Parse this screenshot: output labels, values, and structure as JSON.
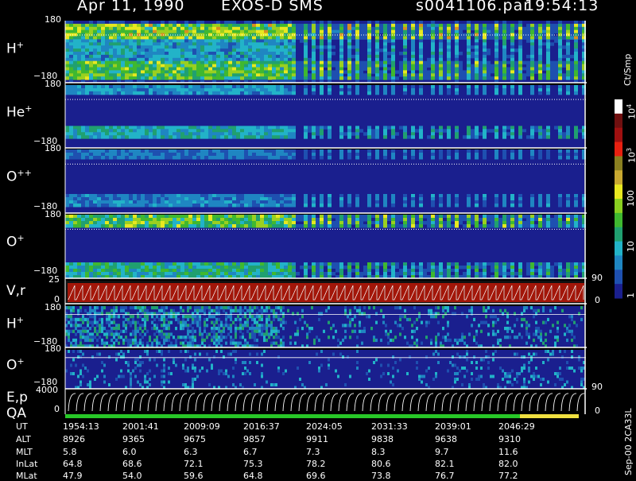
{
  "header": {
    "date": "Apr 11, 1990",
    "instrument": "EXOS-D SMS",
    "file": "s0041106.par",
    "time": "19:54:13"
  },
  "colorbar": {
    "unit": "Ct/Smp",
    "ticks": [
      "1",
      "10",
      "100",
      "10",
      "10"
    ],
    "tick_exps": [
      "",
      "",
      "",
      "3",
      "4"
    ]
  },
  "panels": [
    {
      "name": "H",
      "sup": "+",
      "top": "180",
      "bottom": "−180"
    },
    {
      "name": "He",
      "sup": "+",
      "top": "180",
      "bottom": "−180"
    },
    {
      "name": "O",
      "sup": "++",
      "top": "180",
      "bottom": "−180"
    },
    {
      "name": "O",
      "sup": "+",
      "top": "180",
      "bottom": "−180"
    },
    {
      "name": "V,r",
      "sup": "",
      "top": "25",
      "bottom": "0",
      "rtop": "90",
      "rbottom": "0"
    },
    {
      "name": "H",
      "sup": "+",
      "top": "180",
      "bottom": "−180"
    },
    {
      "name": "O",
      "sup": "+",
      "top": "180",
      "bottom": "−180"
    },
    {
      "name": "E,p",
      "sup": "",
      "top": "4000",
      "bottom": "0",
      "rtop": "90",
      "rbottom": "0"
    }
  ],
  "qa_label": "QA",
  "footer": {
    "row_labels": [
      "UT",
      "ALT",
      "MLT",
      "InLat",
      "MLat"
    ],
    "UT": [
      "1954:13",
      "2001:41",
      "2009:09",
      "2016:37",
      "2024:05",
      "2031:33",
      "2039:01",
      "2046:29"
    ],
    "ALT": [
      "8926",
      "9365",
      "9675",
      "9857",
      "9911",
      "9838",
      "9638",
      "9310"
    ],
    "MLT": [
      "5.8",
      "6.0",
      "6.3",
      "6.7",
      "7.3",
      "8.3",
      "9.7",
      "11.6"
    ],
    "InLat": [
      "64.8",
      "68.6",
      "72.1",
      "75.3",
      "78.2",
      "80.6",
      "82.1",
      "82.0"
    ],
    "MLat": [
      "47.9",
      "54.0",
      "59.6",
      "64.8",
      "69.6",
      "73.8",
      "76.7",
      "77.2"
    ]
  },
  "side_note": "Sep-00 2CA33L",
  "chart_data": {
    "type": "heatmap",
    "title": "Apr 11, 1990   EXOS-D SMS",
    "x_ticks": [
      "1954:13",
      "2001:41",
      "2009:09",
      "2016:37",
      "2024:05",
      "2031:33",
      "2039:01",
      "2046:29"
    ],
    "y_range_pitch": [
      -180,
      180
    ],
    "colorbar_range": [
      1,
      10000
    ],
    "colorbar_scale": "log",
    "series": [
      {
        "name": "H+",
        "ylim": [
          -180,
          180
        ]
      },
      {
        "name": "He+",
        "ylim": [
          -180,
          180
        ]
      },
      {
        "name": "O++",
        "ylim": [
          -180,
          180
        ]
      },
      {
        "name": "O+",
        "ylim": [
          -180,
          180
        ]
      },
      {
        "name": "V,r",
        "ylim": [
          0,
          25
        ],
        "ylim_right": [
          0,
          90
        ]
      },
      {
        "name": "H+",
        "ylim": [
          -180,
          180
        ]
      },
      {
        "name": "O+",
        "ylim": [
          -180,
          180
        ]
      },
      {
        "name": "E,p",
        "ylim": [
          0,
          4000
        ],
        "ylim_right": [
          0,
          90
        ]
      }
    ]
  }
}
